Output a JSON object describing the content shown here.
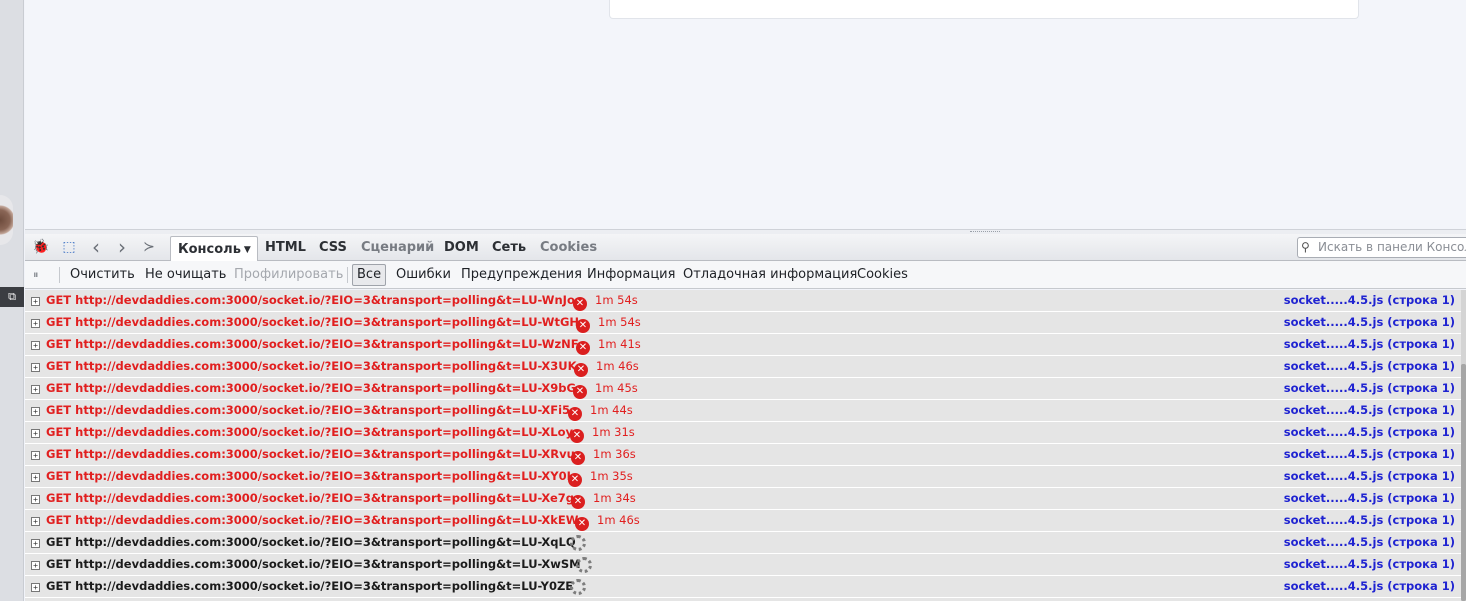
{
  "left_panel": {
    "restore_icon": "window-restore-icon",
    "restore_glyph": "⧉"
  },
  "devtools": {
    "tool_icons": {
      "firebug": "🐞",
      "inspect": "⬚",
      "back": "‹",
      "forward": "›",
      "command_line": "≻"
    },
    "tabs": {
      "console": "Консоль",
      "console_caret": "▼",
      "html": "HTML",
      "css": "CSS",
      "script": "Сценарий",
      "dom": "DOM",
      "net": "Сеть",
      "cookies": "Cookies"
    },
    "search": {
      "placeholder": "Искать в панели Консоль",
      "icon": "⚲"
    }
  },
  "console_toolbar": {
    "pause_icon": "⏸",
    "clear": "Очистить",
    "persist": "Не очищать",
    "profile": "Профилировать",
    "filter_all": "Все",
    "filter_errors": "Ошибки",
    "filter_warnings": "Предупреждения",
    "filter_info": "Информация",
    "filter_debug": "Отладочная информация",
    "filter_cookies": "Cookies"
  },
  "console_rows": [
    {
      "text": "GET http://devdaddies.com:3000/socket.io/?EIO=3&transport=polling&t=LU-WnJo",
      "state": "error",
      "time": "1m 54s",
      "source": "socket.....4.5.js (строка 1)"
    },
    {
      "text": "GET http://devdaddies.com:3000/socket.io/?EIO=3&transport=polling&t=LU-WtGH",
      "state": "error",
      "time": "1m 54s",
      "source": "socket.....4.5.js (строка 1)"
    },
    {
      "text": "GET http://devdaddies.com:3000/socket.io/?EIO=3&transport=polling&t=LU-WzNF",
      "state": "error",
      "time": "1m 41s",
      "source": "socket.....4.5.js (строка 1)"
    },
    {
      "text": "GET http://devdaddies.com:3000/socket.io/?EIO=3&transport=polling&t=LU-X3UK",
      "state": "error",
      "time": "1m 46s",
      "source": "socket.....4.5.js (строка 1)"
    },
    {
      "text": "GET http://devdaddies.com:3000/socket.io/?EIO=3&transport=polling&t=LU-X9bG",
      "state": "error",
      "time": "1m 45s",
      "source": "socket.....4.5.js (строка 1)"
    },
    {
      "text": "GET http://devdaddies.com:3000/socket.io/?EIO=3&transport=polling&t=LU-XFi5",
      "state": "error",
      "time": "1m 44s",
      "source": "socket.....4.5.js (строка 1)"
    },
    {
      "text": "GET http://devdaddies.com:3000/socket.io/?EIO=3&transport=polling&t=LU-XLoy",
      "state": "error",
      "time": "1m 31s",
      "source": "socket.....4.5.js (строка 1)"
    },
    {
      "text": "GET http://devdaddies.com:3000/socket.io/?EIO=3&transport=polling&t=LU-XRvu",
      "state": "error",
      "time": "1m 36s",
      "source": "socket.....4.5.js (строка 1)"
    },
    {
      "text": "GET http://devdaddies.com:3000/socket.io/?EIO=3&transport=polling&t=LU-XY0I",
      "state": "error",
      "time": "1m 35s",
      "source": "socket.....4.5.js (строка 1)"
    },
    {
      "text": "GET http://devdaddies.com:3000/socket.io/?EIO=3&transport=polling&t=LU-Xe7g",
      "state": "error",
      "time": "1m 34s",
      "source": "socket.....4.5.js (строка 1)"
    },
    {
      "text": "GET http://devdaddies.com:3000/socket.io/?EIO=3&transport=polling&t=LU-XkEW",
      "state": "error",
      "time": "1m 46s",
      "source": "socket.....4.5.js (строка 1)"
    },
    {
      "text": "GET http://devdaddies.com:3000/socket.io/?EIO=3&transport=polling&t=LU-XqLQ",
      "state": "pending",
      "time": "",
      "source": "socket.....4.5.js (строка 1)"
    },
    {
      "text": "GET http://devdaddies.com:3000/socket.io/?EIO=3&transport=polling&t=LU-XwSM",
      "state": "pending",
      "time": "",
      "source": "socket.....4.5.js (строка 1)"
    },
    {
      "text": "GET http://devdaddies.com:3000/socket.io/?EIO=3&transport=polling&t=LU-Y0ZE",
      "state": "pending",
      "time": "",
      "source": "socket.....4.5.js (строка 1)"
    }
  ],
  "colors": {
    "error": "#e11f1f",
    "link": "#1f23d1",
    "row_bg": "#e5e5e5"
  }
}
